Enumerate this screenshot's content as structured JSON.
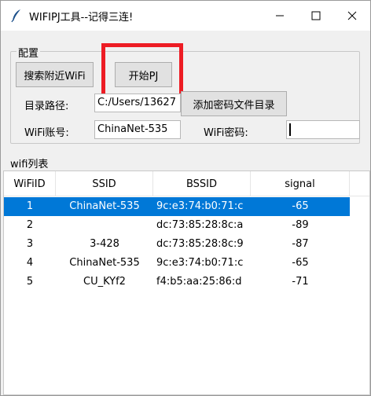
{
  "window": {
    "title": "WIFIPJ工具--记得三连!"
  },
  "config": {
    "group_label": "配置",
    "search_button": "搜索附近WiFi",
    "start_button": "开始PJ",
    "path_label": "目录路径:",
    "path_value": "C:/Users/13627",
    "add_dir_button": "添加密码文件目录",
    "account_label": "WiFi账号:",
    "account_value": "ChinaNet-535",
    "password_label": "WiFi密码:",
    "password_value": ""
  },
  "wifi_list": {
    "group_label": "wifi列表",
    "columns": [
      "WiFiID",
      "SSID",
      "BSSID",
      "signal"
    ],
    "rows": [
      {
        "id": "1",
        "ssid": "ChinaNet-535",
        "bssid": "9c:e3:74:b0:71:c",
        "signal": "-65",
        "selected": true
      },
      {
        "id": "2",
        "ssid": "",
        "bssid": "dc:73:85:28:8c:a",
        "signal": "-89",
        "selected": false
      },
      {
        "id": "3",
        "ssid": "3-428",
        "bssid": "dc:73:85:28:8c:9",
        "signal": "-87",
        "selected": false
      },
      {
        "id": "4",
        "ssid": "ChinaNet-535",
        "bssid": "9c:e3:74:b0:71:c",
        "signal": "-65",
        "selected": false
      },
      {
        "id": "5",
        "ssid": "CU_KYf2",
        "bssid": "f4:b5:aa:25:86:d",
        "signal": "-71",
        "selected": false
      }
    ]
  },
  "colors": {
    "selection": "#0078d7",
    "highlight": "#ed1c24"
  }
}
